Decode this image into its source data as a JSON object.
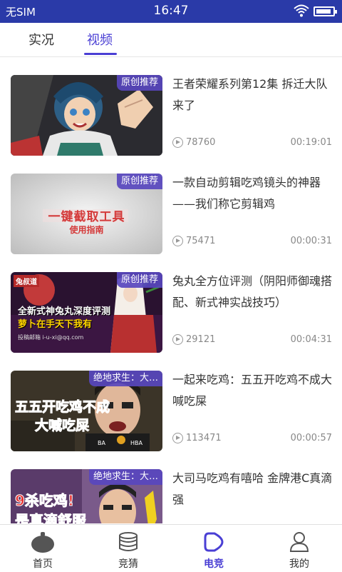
{
  "status": {
    "carrier": "无SIM",
    "time": "16:47"
  },
  "tabs": [
    {
      "label": "实况"
    },
    {
      "label": "视频"
    }
  ],
  "videos": [
    {
      "tag": "原创推荐",
      "title": "王者荣耀系列第12集  拆迁大队来了",
      "views": "78760",
      "duration": "00:19:01"
    },
    {
      "tag": "原创推荐",
      "title": "一款自动剪辑吃鸡镜头的神器——我们称它剪辑鸡",
      "views": "75471",
      "duration": "00:00:31",
      "thumb_text": [
        "一键截取工具",
        "使用指南"
      ]
    },
    {
      "tag": "原创推荐",
      "title": "兔丸全方位评测（阴阳师御魂搭配、新式神实战技巧）",
      "views": "29121",
      "duration": "00:04:31",
      "thumb_text": [
        "全新式神兔丸深度评测",
        "萝卜在手天下我有",
        "兔叔道",
        "投稿邮箱 i-u-xi@qq.com"
      ]
    },
    {
      "tag": "绝地求生：大…",
      "title": "一起来吃鸡：五五开吃鸡不成大喊吃屎",
      "views": "113471",
      "duration": "00:00:57",
      "thumb_text": [
        "五五开吃鸡不成",
        "大喊吃屎"
      ]
    },
    {
      "tag": "绝地求生：大…",
      "title": "大司马吃鸡有嘻哈  金牌港C真滴强",
      "views": "",
      "duration": "",
      "thumb_text": [
        "9杀吃鸡!",
        "是真滴舒服"
      ]
    }
  ],
  "nav": [
    {
      "label": "首页"
    },
    {
      "label": "竞猜"
    },
    {
      "label": "电竞"
    },
    {
      "label": "我的"
    }
  ],
  "colors": {
    "statusbar": "#2a3aa8",
    "accent": "#4a3fd4",
    "tag_bg": "#5846be"
  }
}
